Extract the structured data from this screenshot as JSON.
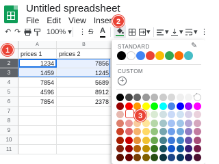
{
  "app": {
    "title": "Untitled spreadsheet",
    "menus": [
      "File",
      "Edit",
      "View",
      "Insert"
    ]
  },
  "toolbar": {
    "undo_icon": "undo-icon",
    "redo_icon": "redo-icon",
    "print_icon": "print-icon",
    "paint_format_icon": "paint-format-icon",
    "zoom": "100%",
    "dropdown_arrow": "▾",
    "strikethrough": "S",
    "text_color": "A",
    "fill_color_icon": "fill-color-icon",
    "borders_icon": "borders-icon",
    "merge_icon": "merge-cells-icon",
    "align_icon": "align-icon",
    "valign_icon": "vertical-align-icon",
    "wrap_icon": "wrap-icon"
  },
  "sheet": {
    "columns": [
      "A",
      "B"
    ],
    "header_row": {
      "row": "1",
      "a": "prices 1",
      "b": "prices 2"
    },
    "rows": [
      {
        "row": "2",
        "a": "1234",
        "b": "7856"
      },
      {
        "row": "3",
        "a": "1459",
        "b": "1245"
      },
      {
        "row": "4",
        "a": "7854",
        "b": "5689"
      },
      {
        "row": "5",
        "a": "4596",
        "b": "8912"
      },
      {
        "row": "6",
        "a": "7854",
        "b": "2378"
      },
      {
        "row": "7",
        "a": "",
        "b": ""
      },
      {
        "row": "8",
        "a": "",
        "b": ""
      },
      {
        "row": "9",
        "a": "",
        "b": ""
      },
      {
        "row": "10",
        "a": "",
        "b": ""
      },
      {
        "row": "11",
        "a": "",
        "b": ""
      }
    ]
  },
  "badges": [
    "1",
    "2",
    "3"
  ],
  "color_panel": {
    "standard_label": "STANDARD",
    "custom_label": "CUSTOM",
    "add_custom": "+",
    "pencil_icon": "pencil-icon",
    "check_icon": "check-icon",
    "standard_colors": [
      "#000000",
      "#ffffff",
      "#4285f4",
      "#ea4335",
      "#fbbc04",
      "#34a853",
      "#ff6d01",
      "#46bdc6"
    ],
    "palette": [
      [
        "#000000",
        "#434343",
        "#666666",
        "#999999",
        "#b7b7b7",
        "#cccccc",
        "#d9d9d9",
        "#efefef",
        "#f3f3f3",
        "#ffffff"
      ],
      [
        "#980000",
        "#ff0000",
        "#ff9900",
        "#ffff00",
        "#00ff00",
        "#00ffff",
        "#4a86e8",
        "#0000ff",
        "#9900ff",
        "#ff00ff"
      ],
      [
        "#e6b8af",
        "#f4cccc",
        "#fce5cd",
        "#fff2cc",
        "#d9ead3",
        "#d0e0e3",
        "#c9daf8",
        "#cfe2f3",
        "#d9d2e9",
        "#ead1dc"
      ],
      [
        "#dd7e6b",
        "#ea9999",
        "#f9cb9c",
        "#ffe599",
        "#b6d7a8",
        "#a2c4c9",
        "#a4c2f4",
        "#9fc5e8",
        "#b4a7d6",
        "#d5a6bd"
      ],
      [
        "#cc4125",
        "#e06666",
        "#f6b26b",
        "#ffd966",
        "#93c47d",
        "#76a5af",
        "#6d9eeb",
        "#6fa8dc",
        "#8e7cc3",
        "#c27ba0"
      ],
      [
        "#a61c00",
        "#cc0000",
        "#e69138",
        "#f1c232",
        "#6aa84f",
        "#45818e",
        "#3c78d8",
        "#3d85c6",
        "#674ea7",
        "#a64d79"
      ],
      [
        "#85200c",
        "#990000",
        "#b45f06",
        "#bf9000",
        "#38761d",
        "#134f5c",
        "#1155cc",
        "#0b5394",
        "#351c75",
        "#741b47"
      ],
      [
        "#5b0f00",
        "#660000",
        "#783f04",
        "#7f6000",
        "#274e13",
        "#0c343d",
        "#1c4587",
        "#073763",
        "#20124d",
        "#4c1130"
      ]
    ]
  },
  "colors": {
    "accent": "#1a73e8",
    "badge": "#ea4335",
    "selection_fill": "#e8f0fe",
    "sheets_green": "#0f9d58"
  }
}
